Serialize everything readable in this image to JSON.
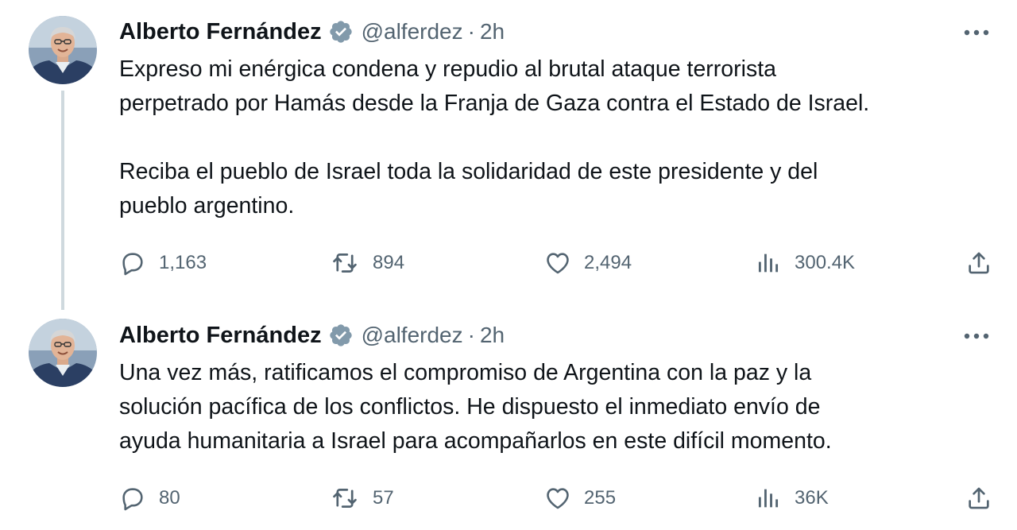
{
  "tweets": [
    {
      "author": {
        "name": "Alberto Fernández",
        "handle": "@alferdez",
        "separator": "·",
        "time": "2h"
      },
      "text": "Expreso mi enérgica condena y repudio al brutal ataque terrorista\nperpetrado por Hamás desde la Franja de Gaza contra el Estado de Israel.\n\nReciba el pueblo de Israel toda la solidaridad de este presidente y del\npueblo argentino.",
      "stats": {
        "replies": "1,163",
        "retweets": "894",
        "likes": "2,494",
        "views": "300.4K"
      }
    },
    {
      "author": {
        "name": "Alberto Fernández",
        "handle": "@alferdez",
        "separator": "·",
        "time": "2h"
      },
      "text": "Una vez más, ratificamos el compromiso de Argentina con la paz y la\nsolución pacífica de los conflictos. He dispuesto el inmediato envío de\nayuda humanitaria a Israel para acompañarlos en este difícil momento.",
      "stats": {
        "replies": "80",
        "retweets": "57",
        "likes": "255",
        "views": "36K"
      }
    }
  ],
  "icons": {
    "verified": "verified-badge-icon",
    "more": "more-options-icon",
    "reply": "reply-icon",
    "retweet": "retweet-icon",
    "like": "like-icon",
    "views": "views-icon",
    "share": "share-icon"
  },
  "colors": {
    "text": "#0f1419",
    "secondary": "#536471",
    "verified_badge": "#829aab",
    "thread_line": "#cfd9de"
  }
}
